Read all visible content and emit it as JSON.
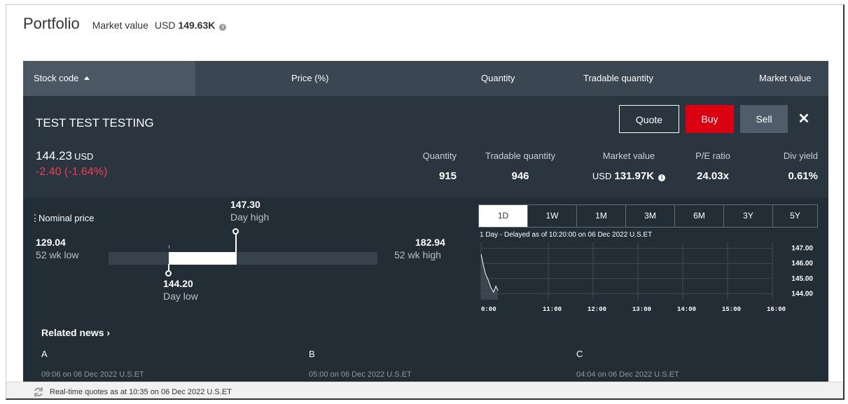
{
  "header": {
    "title": "Portfolio",
    "market_value_label": "Market value",
    "currency": "USD",
    "market_value": "149.63K",
    "info_icon": "info-icon"
  },
  "columns": [
    {
      "label": "Stock code",
      "sort": "ascending"
    },
    {
      "label": "Price (%)"
    },
    {
      "label": "Quantity"
    },
    {
      "label": "Tradable quantity"
    },
    {
      "label": "Market value"
    }
  ],
  "stock": {
    "name": "TEST TEST TESTING",
    "price": "144.23",
    "price_currency": "USD",
    "change": "-2.40  (-1.64%)",
    "change_color": "#e8414f",
    "buttons": {
      "quote": "Quote",
      "buy": "Buy",
      "sell": "Sell",
      "close": "✕"
    },
    "stats": [
      {
        "label": "Quantity",
        "value": "915"
      },
      {
        "label": "Tradable quantity",
        "value": "946"
      },
      {
        "label": "Market value",
        "currency": "USD",
        "value": "131.97K"
      },
      {
        "label": "P/E ratio",
        "value": "24.03x"
      },
      {
        "label": "Div yield",
        "value": "0.61%"
      }
    ]
  },
  "range": {
    "nominal_label": "Nominal price",
    "low52": "129.04",
    "low52_label": "52 wk low",
    "high52": "182.94",
    "high52_label": "52 wk high",
    "day_high": "147.30",
    "day_high_label": "Day high",
    "day_low": "144.20",
    "day_low_label": "Day low"
  },
  "chart_tabs": [
    "1D",
    "1W",
    "1M",
    "3M",
    "6M",
    "3Y",
    "5Y"
  ],
  "chart_active_tab": "1D",
  "chart_delay_text": "1 Day - Delayed as of 10:20:00 on 06 Dec 2022 U.S.ET",
  "chart_data": {
    "type": "line",
    "x_ticks": [
      "0:00",
      "11:00",
      "12:00",
      "13:00",
      "14:00",
      "15:00",
      "16:00"
    ],
    "y_ticks": [
      "147.00",
      "146.00",
      "145.00",
      "144.00"
    ],
    "ylim": [
      143.6,
      147.4
    ],
    "series": [
      {
        "x": [
          9.5,
          9.55,
          9.6,
          9.66,
          9.72,
          9.78,
          9.83,
          9.88
        ],
        "values": [
          146.6,
          145.9,
          145.3,
          144.9,
          144.4,
          144.1,
          144.5,
          144.2
        ]
      }
    ],
    "grid": true
  },
  "news": {
    "title": "Related news ›",
    "items": [
      {
        "headline": "A",
        "time": "09:06 on 06 Dec 2022 U.S.ET"
      },
      {
        "headline": "B",
        "time": "05:00 on 06 Dec 2022 U.S.ET"
      },
      {
        "headline": "C",
        "time": "04:04 on 06 Dec 2022 U.S.ET"
      }
    ]
  },
  "footer": {
    "text": "Real-time quotes as at 10:35 on 06 Dec 2022 U.S.ET",
    "icon": "refresh-icon"
  }
}
